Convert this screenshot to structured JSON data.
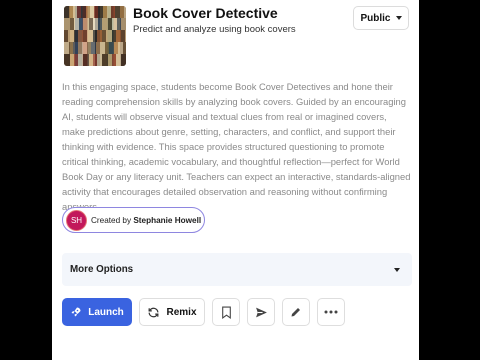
{
  "app": {
    "title": "Book Cover Detective",
    "subtitle": "Predict and analyze using book covers",
    "visibility": "Public"
  },
  "description": "In this engaging space, students become Book Cover Detectives and hone their reading comprehension skills by analyzing book covers. Guided by an encouraging AI, students will observe visual and textual clues from real or imagined covers, make predictions about genre, setting, characters, and conflict, and support their thinking with evidence. This space provides structured questioning to promote critical thinking, academic vocabulary, and thoughtful reflection—perfect for World Book Day or any literacy unit. Teachers can expect an interactive, standards-aligned activity that encourages detailed observation and reasoning without confirming answers.",
  "creator": {
    "initials": "SH",
    "prefix": "Created by",
    "name": "Stephanie Howell"
  },
  "more_options": {
    "label": "More Options"
  },
  "actions": {
    "launch": "Launch",
    "remix": "Remix"
  },
  "colors": {
    "accent": "#3a63e0",
    "creator_border": "#8e86e0",
    "avatar": "#c2185b",
    "more_bg": "#f3f6fb"
  },
  "icons": [
    "rocket-icon",
    "remix-icon",
    "bookmark-icon",
    "send-icon",
    "pencil-icon",
    "more-icon",
    "caret-down-icon"
  ]
}
